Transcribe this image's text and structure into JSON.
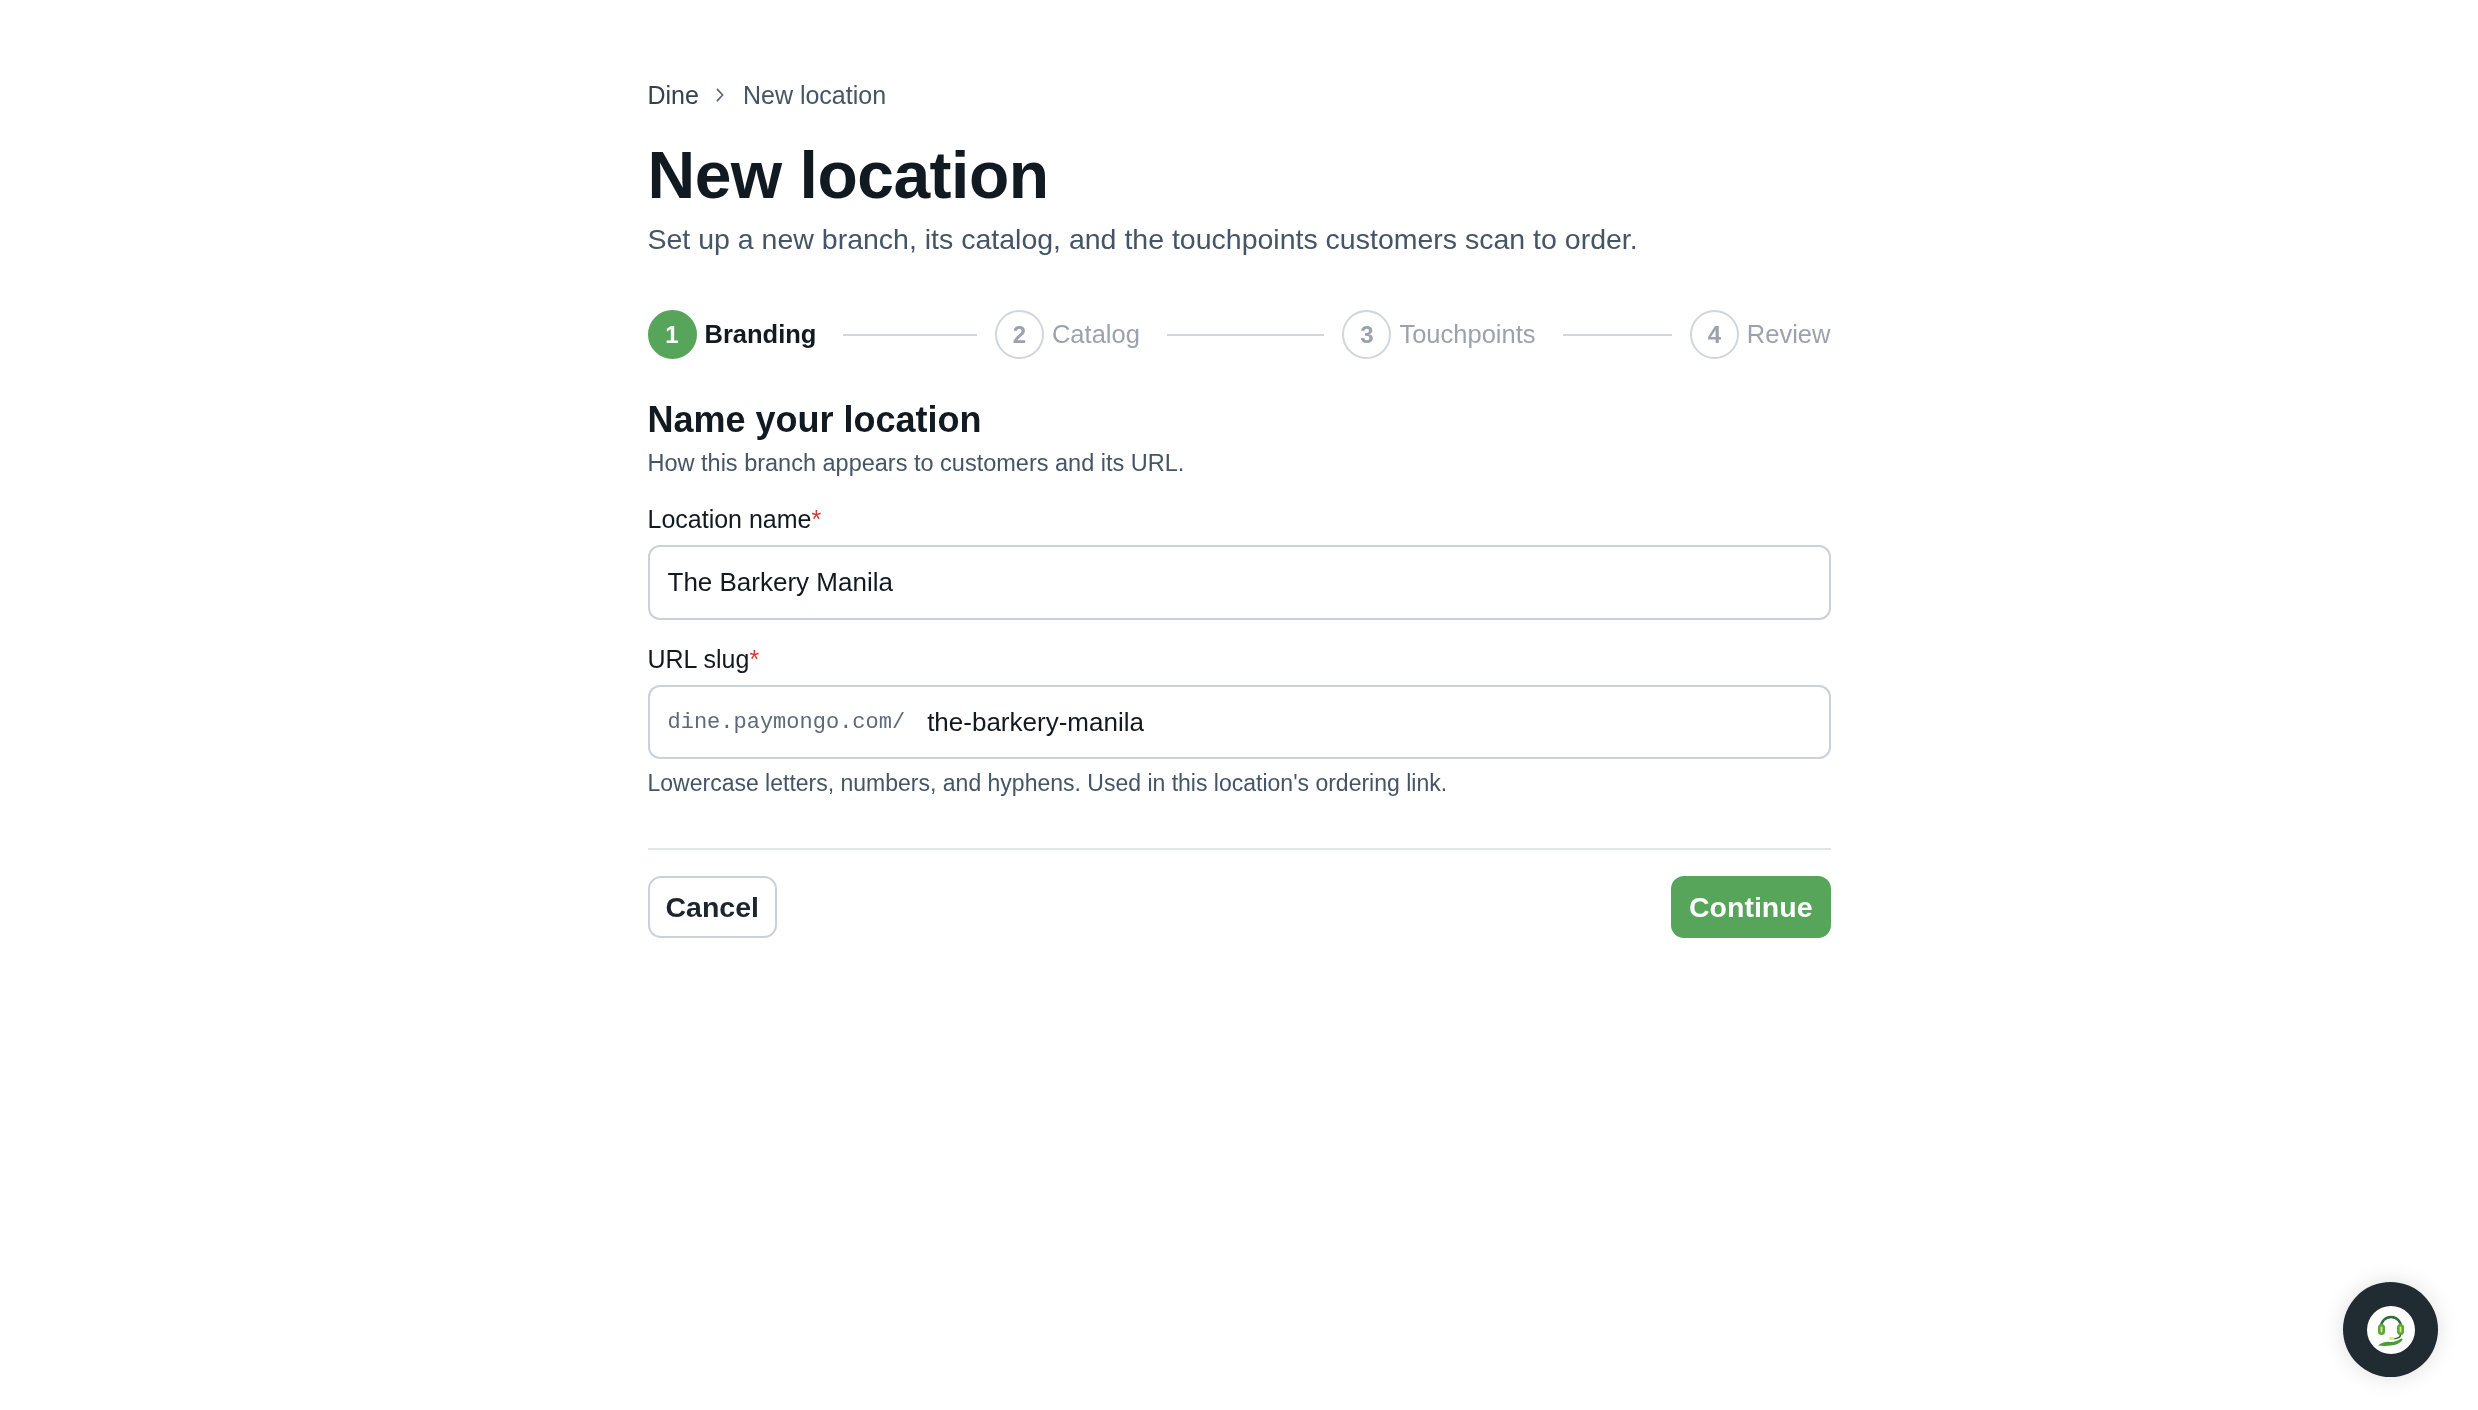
{
  "breadcrumb": [
    {
      "label": "Dine"
    },
    {
      "label": "New location"
    }
  ],
  "title": "New location",
  "subtitle": "Set up a new branch, its catalog, and the touchpoints customers scan to order.",
  "steps": [
    {
      "number": "1",
      "label": "Branding",
      "selected": true
    },
    {
      "number": "2",
      "label": "Catalog",
      "selected": false
    },
    {
      "number": "3",
      "label": "Touchpoints",
      "selected": false
    },
    {
      "number": "4",
      "label": "Review",
      "selected": false
    }
  ],
  "section": {
    "heading": "Name your location",
    "description": "How this branch appears to customers and its URL."
  },
  "fields": [
    {
      "kind": "text",
      "label": "Location name",
      "required_mark": "*",
      "value": "The Barkery Manila"
    },
    {
      "kind": "prefixed",
      "label": "URL slug",
      "required_mark": "*",
      "prefix": "dine.paymongo.com/",
      "value": "the-barkery-manila",
      "help": "Lowercase letters, numbers, and hyphens. Used in this location's ordering link."
    }
  ],
  "actions": [
    {
      "kind": "secondary",
      "label": "Cancel"
    },
    {
      "kind": "primary",
      "label": "Continue"
    }
  ]
}
